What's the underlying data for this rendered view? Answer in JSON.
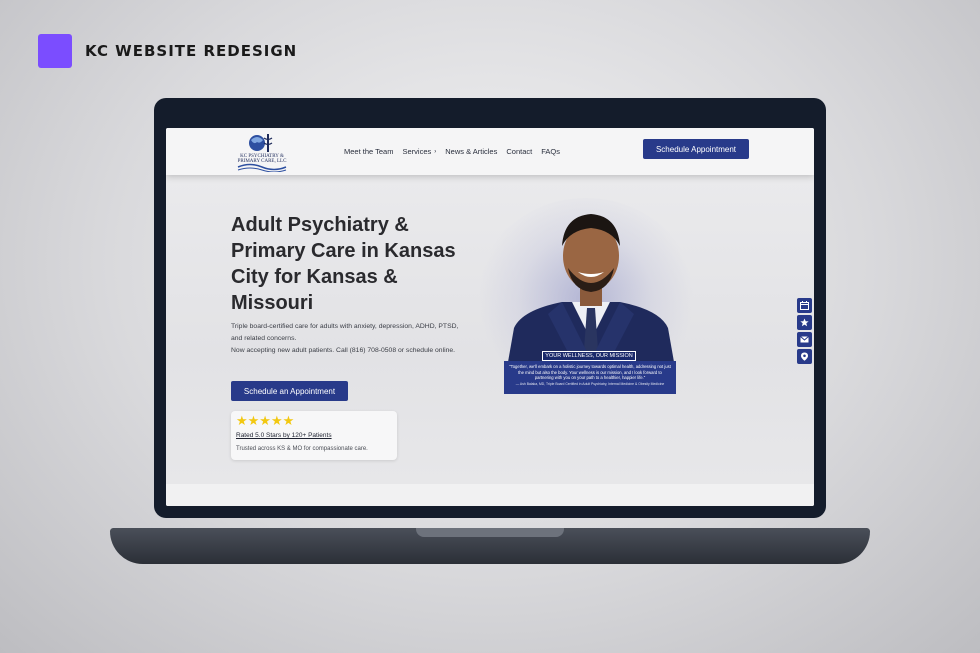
{
  "brand": {
    "title": "KC WEBSITE REDESIGN",
    "accent": "#7b4dff"
  },
  "site": {
    "logo_text": "KC PSYCHIATRY & PRIMARY CARE, LLC",
    "nav": [
      {
        "label": "Meet the Team"
      },
      {
        "label": "Services",
        "chevron": "›"
      },
      {
        "label": "News & Articles"
      },
      {
        "label": "Contact"
      },
      {
        "label": "FAQs"
      }
    ],
    "cta_top": "Schedule Appointment",
    "hero": {
      "title": "Adult Psychiatry & Primary Care in Kansas City for Kansas & Missouri",
      "desc_line1": "Triple board-certified care for adults with anxiety, depression, ADHD, PTSD, and related concerns.",
      "desc_line2": "Now accepting new adult patients. Call (816) 708-0508 or schedule online.",
      "cta": "Schedule an Appointment"
    },
    "rating": {
      "stars": "★★★★★",
      "value": 5,
      "link": "Rated 5.0 Stars by 120+ Patients",
      "trust": "Trusted across KS & MO for compassionate care."
    },
    "mission": {
      "label": "YOUR WELLNESS, OUR MISSION",
      "quote": "\"Together, we'll embark on a holistic journey towards optimal health, addressing not just the mind but also the body. Your wellness is our mission, and I look forward to partnering with you on your path to a healthier, happier life.\"",
      "signature": "— Ash Balaka, MD, Triple Board Certified in Adult Psychiatry, Internal Medicine & Obesity Medicine"
    },
    "side_rail": [
      {
        "icon": "calendar-icon"
      },
      {
        "icon": "star-icon"
      },
      {
        "icon": "mail-icon"
      },
      {
        "icon": "location-pin-icon"
      }
    ],
    "colors": {
      "primary": "#283a8a",
      "navy": "#1b2a6b",
      "star": "#f2c811"
    }
  }
}
